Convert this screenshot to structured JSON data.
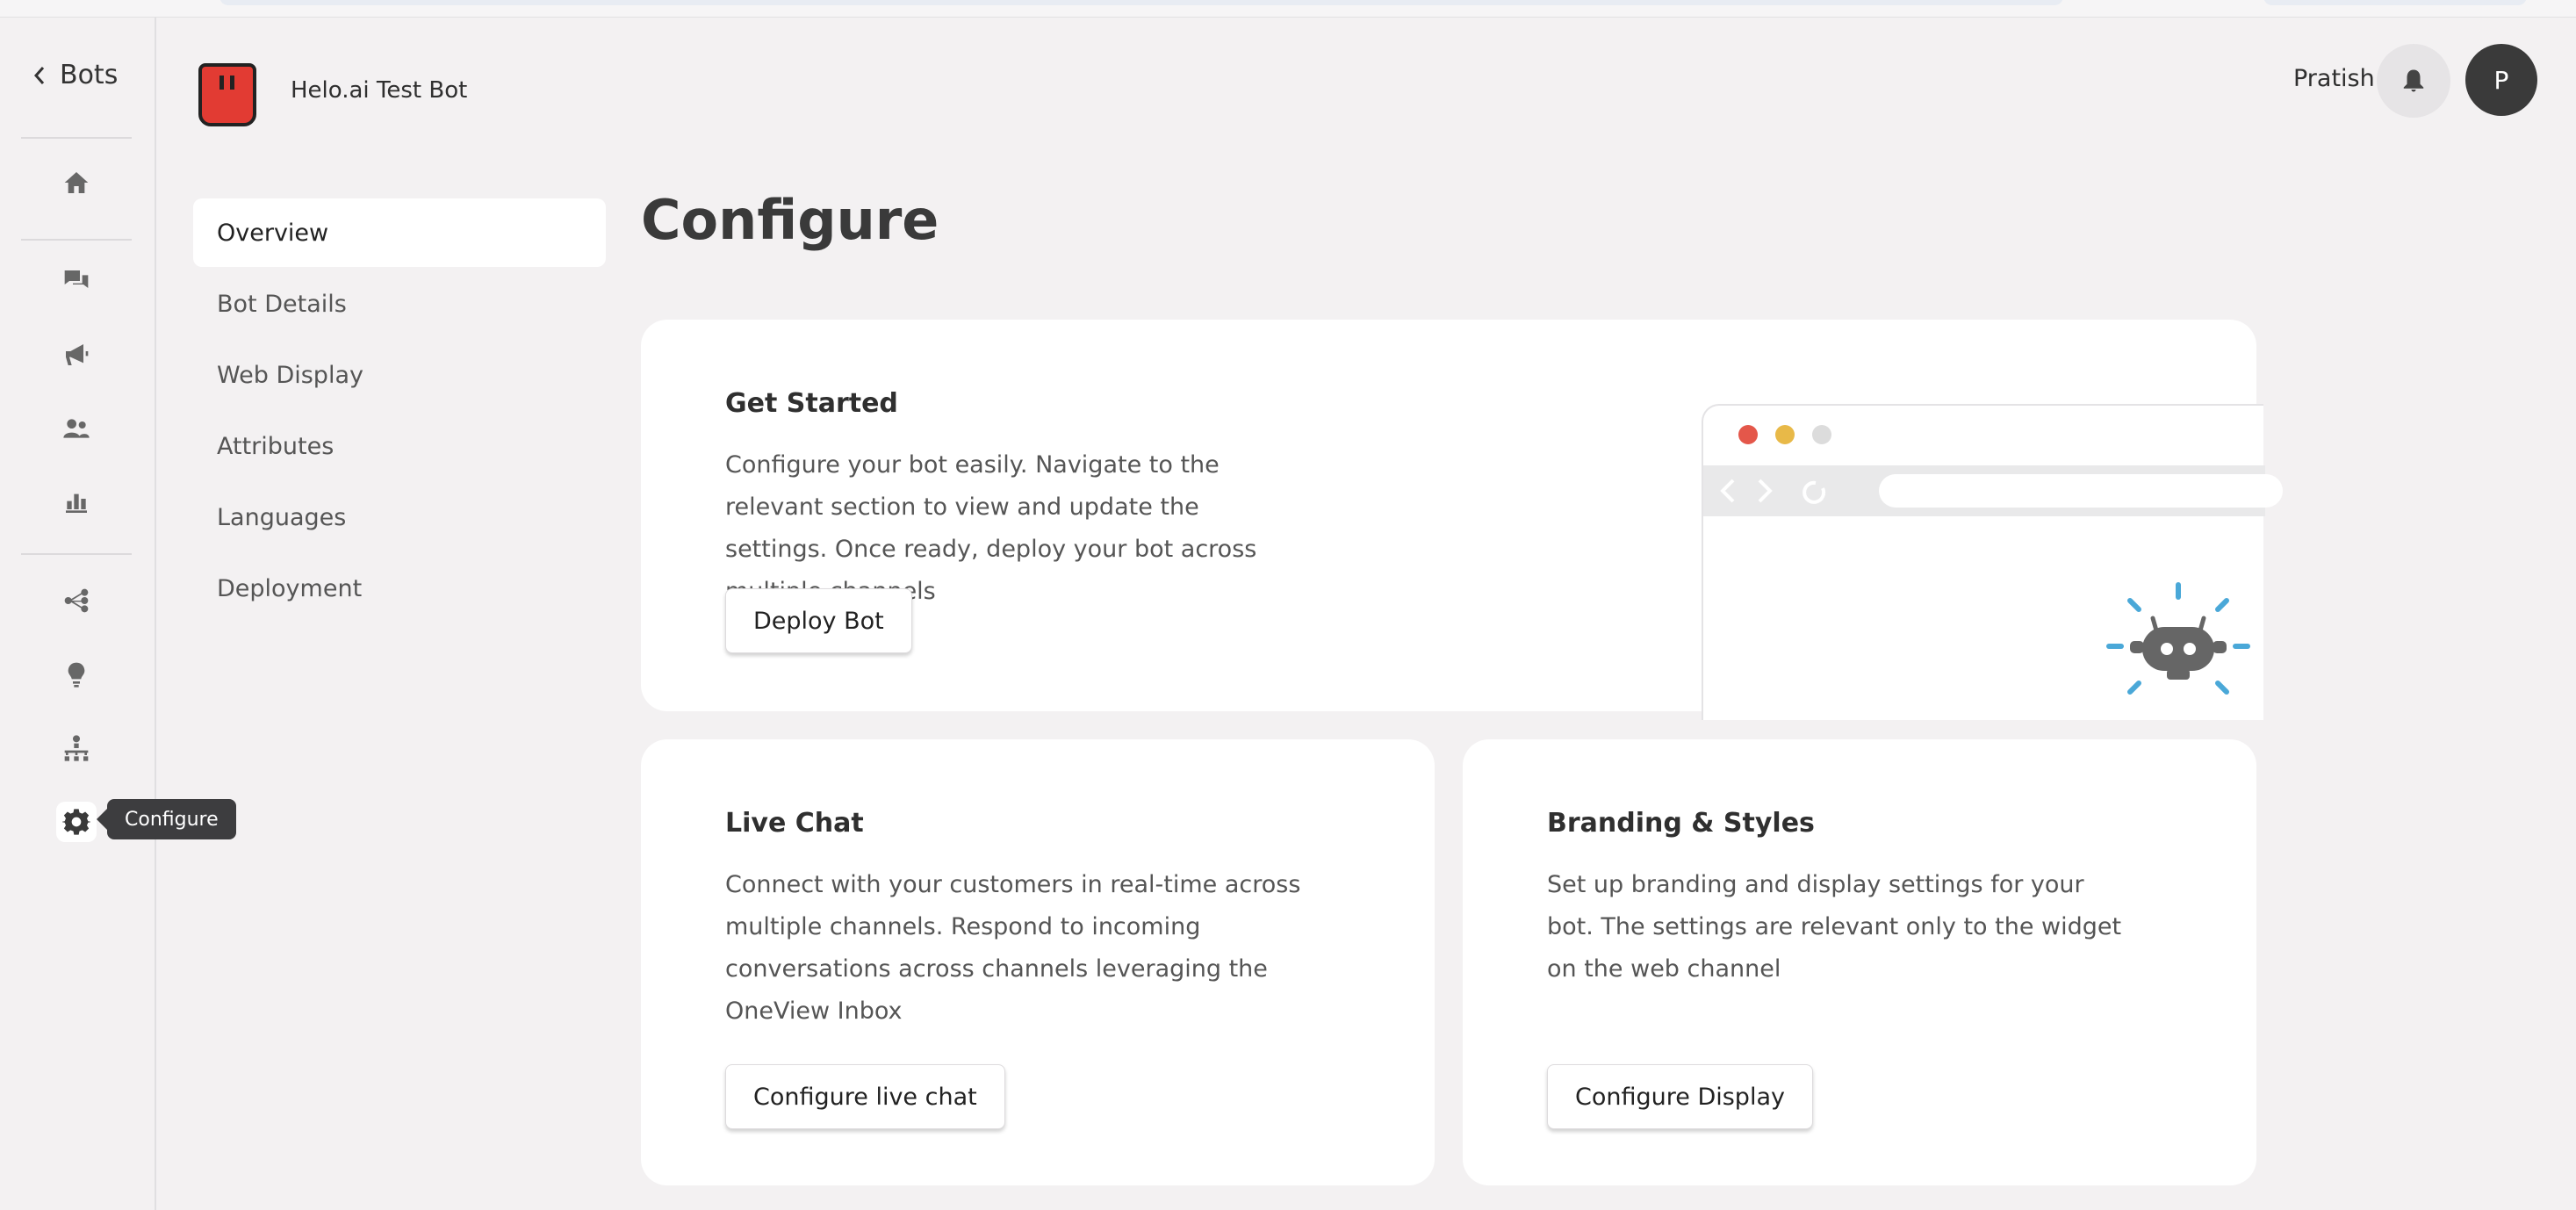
{
  "nav": {
    "back_label": "Bots",
    "active_tooltip": "Configure",
    "icons": [
      "home-icon",
      "chat-icon",
      "megaphone-icon",
      "users-icon",
      "bar-chart-icon",
      "flow-icon",
      "bulb-icon",
      "hierarchy-icon",
      "gear-icon"
    ]
  },
  "header": {
    "bot_name": "Helo.ai Test Bot",
    "user_name": "Pratish",
    "avatar_initial": "P"
  },
  "subnav": {
    "items": [
      "Overview",
      "Bot Details",
      "Web Display",
      "Attributes",
      "Languages",
      "Deployment"
    ],
    "active": "Overview"
  },
  "page": {
    "title": "Configure"
  },
  "cards": {
    "get_started": {
      "title": "Get Started",
      "description": "Configure your bot easily. Navigate to the relevant section to view and update the settings. Once ready, deploy your bot across multiple channels",
      "button": "Deploy Bot"
    },
    "live_chat": {
      "title": "Live Chat",
      "description": "Connect with your customers in real-time across multiple channels. Respond to incoming conversations across channels leveraging the OneView Inbox",
      "button": "Configure live chat"
    },
    "branding": {
      "title": "Branding & Styles",
      "description": "Set up branding and display settings for your bot. The settings are relevant only to the widget on the web channel",
      "button": "Configure Display"
    }
  },
  "colors": {
    "background": "#f3f1f2",
    "card": "#ffffff",
    "bot_logo_red": "#e23b33",
    "robot_accent": "#4aa8d8",
    "dot_red": "#e4574a",
    "dot_yellow": "#e8b948",
    "dot_grey": "#dcdcdc"
  }
}
